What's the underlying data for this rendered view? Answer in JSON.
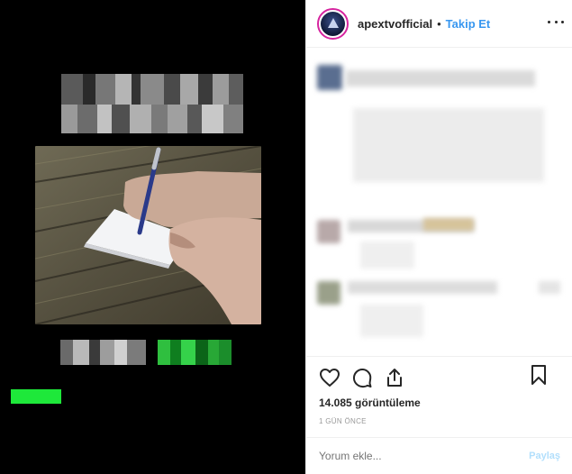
{
  "colors": {
    "accent": "#3897f0",
    "media_background": "#000000",
    "censor_green": "#1ee83a",
    "text": "#262626",
    "muted": "#8e8e8e"
  },
  "media": {
    "type": "video",
    "redacted_title": true,
    "photo_description_visible": "hand writing on paper with pen on wooden table"
  },
  "header": {
    "avatar_icon": "channel-logo-icon",
    "username": "apextvofficial",
    "separator": "•",
    "follow_label": "Takip Et",
    "more_icon": "more-options-icon"
  },
  "comments": {
    "count_visible": 3,
    "redacted": true
  },
  "actions": {
    "like_icon": "heart-icon",
    "comment_icon": "comment-icon",
    "share_icon": "share-icon",
    "save_icon": "bookmark-icon",
    "views": "14.085 görüntüleme",
    "time_ago": "1 GÜN ÖNCE"
  },
  "comment_box": {
    "placeholder": "Yorum ekle...",
    "post_label": "Paylaş"
  }
}
